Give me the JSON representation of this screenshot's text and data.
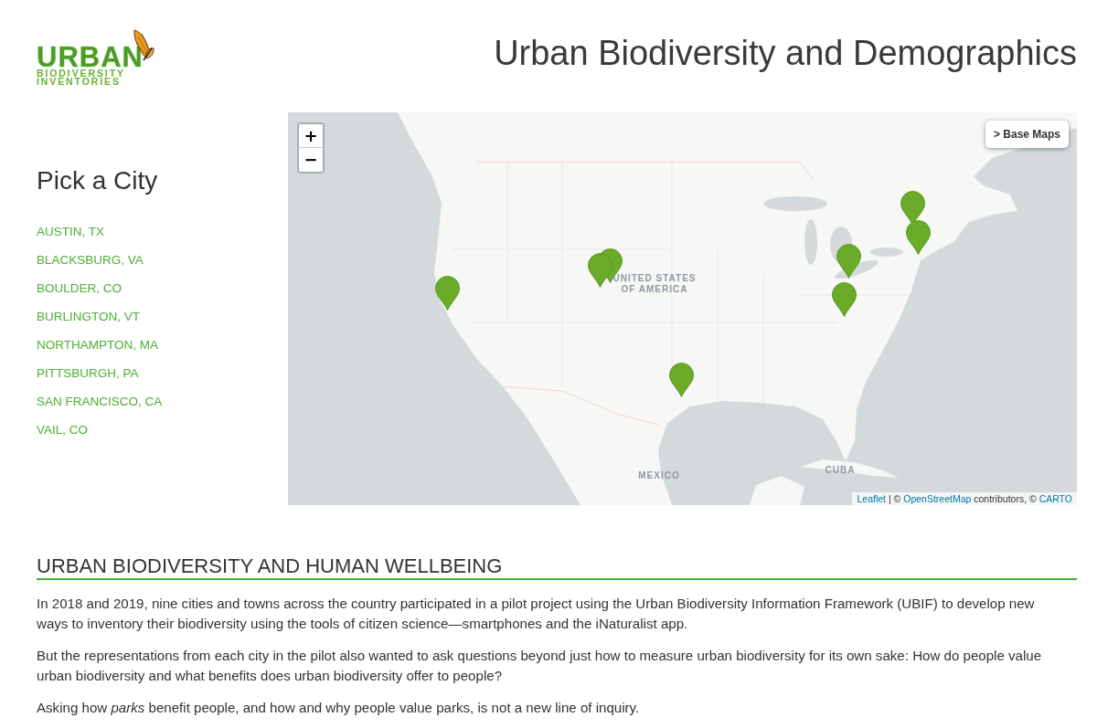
{
  "header": {
    "logo": {
      "lines": [
        "URBAN",
        "BIODIVERSITY",
        "INVENTORIES"
      ]
    },
    "title": "Urban Biodiversity and Demographics"
  },
  "sidebar": {
    "heading": "Pick a City",
    "cities": [
      "AUSTIN, TX",
      "BLACKSBURG, VA",
      "BOULDER, CO",
      "BURLINGTON, VT",
      "NORTHAMPTON, MA",
      "PITTSBURGH, PA",
      "SAN FRANCISCO, CA",
      "VAIL, CO"
    ]
  },
  "map": {
    "zoom_buttons": [
      "+",
      "−"
    ],
    "layers_button": "> Base Maps",
    "labels": [
      "UNITED STATES OF AMERICA",
      "MEXICO",
      "CUBA"
    ],
    "attribution": [
      {
        "kind": "link",
        "text": "Leaflet"
      },
      {
        "kind": "text",
        "text": " | © "
      },
      {
        "kind": "link",
        "text": "OpenStreetMap"
      },
      {
        "kind": "text",
        "text": " contributors, © "
      },
      {
        "kind": "link",
        "text": "CARTO"
      }
    ]
  },
  "section": {
    "heading": "URBAN BIODIVERSITY AND HUMAN WELLBEING",
    "paragraphs": [
      "In 2018 and 2019, nine cities and towns across the country participated in a pilot project using the Urban Biodiversity Information Framework (UBIF) to develop new ways to inventory their biodiversity using the tools of citizen science—smartphones and the iNaturalist app.",
      "But the representations from each city in the pilot also wanted to ask questions beyond just how to measure urban biodiversity for its own sake: How do people value urban biodiversity and what benefits does urban biodiversity offer to people?",
      "Asking how *parks* benefit people, and how and why people value parks, is not a new line of inquiry."
    ]
  }
}
